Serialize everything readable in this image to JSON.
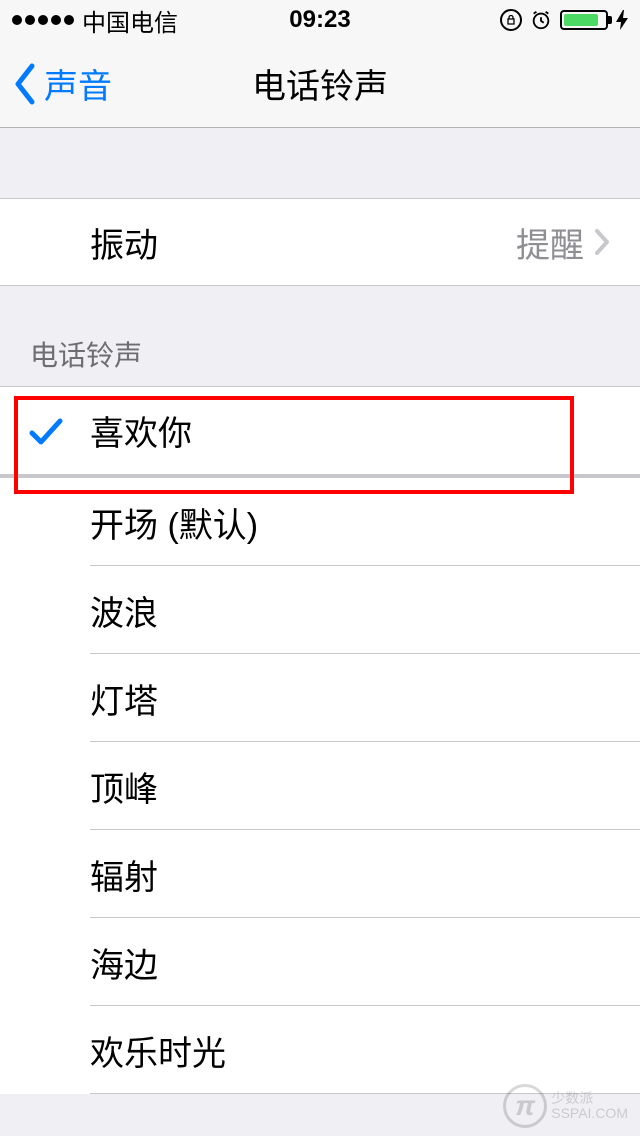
{
  "statusBar": {
    "carrier": "中国电信",
    "time": "09:23"
  },
  "nav": {
    "backLabel": "声音",
    "title": "电话铃声"
  },
  "vibration": {
    "label": "振动",
    "value": "提醒"
  },
  "ringtoneSection": {
    "header": "电话铃声"
  },
  "ringtones": [
    {
      "name": "喜欢你",
      "selected": true
    },
    {
      "name": "开场 (默认)",
      "selected": false
    },
    {
      "name": "波浪",
      "selected": false
    },
    {
      "name": "灯塔",
      "selected": false
    },
    {
      "name": "顶峰",
      "selected": false
    },
    {
      "name": "辐射",
      "selected": false
    },
    {
      "name": "海边",
      "selected": false
    },
    {
      "name": "欢乐时光",
      "selected": false
    }
  ],
  "watermark": {
    "brand": "少数派",
    "url": "SSPAI.COM"
  }
}
